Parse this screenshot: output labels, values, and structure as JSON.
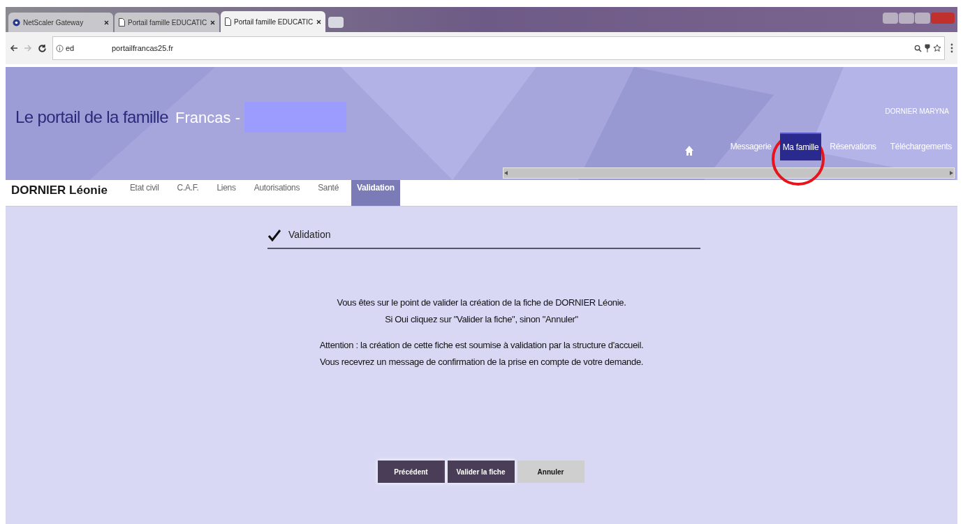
{
  "browser": {
    "tabs": [
      {
        "title": "NetScaler Gateway",
        "selected": false,
        "kind": "gateway"
      },
      {
        "title": "Portail famille EDUCATIC",
        "selected": false,
        "kind": "page"
      },
      {
        "title": "Portail famille EDUCATIC",
        "selected": true,
        "kind": "page"
      }
    ],
    "address": {
      "security_label": "ed",
      "url": "portailfrancas25.fr"
    }
  },
  "header": {
    "title": "Le portail de la famille",
    "subtitle": "Francas -",
    "user": "DORNIER MARYNA",
    "nav": [
      {
        "label": "Messagerie",
        "selected": false
      },
      {
        "label": "Ma famille",
        "selected": true
      },
      {
        "label": "Réservations",
        "selected": false
      },
      {
        "label": "Téléchargements",
        "selected": false
      }
    ]
  },
  "person": {
    "name": "DORNIER Léonie",
    "tabs": [
      {
        "label": "Etat civil",
        "selected": false
      },
      {
        "label": "C.A.F.",
        "selected": false
      },
      {
        "label": "Liens",
        "selected": false
      },
      {
        "label": "Autorisations",
        "selected": false
      },
      {
        "label": "Santé",
        "selected": false
      },
      {
        "label": "Validation",
        "selected": true
      }
    ]
  },
  "section": {
    "title": "Validation",
    "paragraphs": [
      [
        "Vous êtes sur le point de valider la création de la fiche de DORNIER Léonie.",
        "Si Oui cliquez sur \"Valider la fiche\", sinon \"Annuler\""
      ],
      [
        "Attention : la création de cette fiche est soumise à validation par la structure d'accueil.",
        "Vous recevrez un message de confirmation de la prise en compte de votre demande."
      ]
    ],
    "buttons": [
      {
        "label": "Précédent",
        "kind": "primary"
      },
      {
        "label": "Valider la fiche",
        "kind": "primary"
      },
      {
        "label": "Annuler",
        "kind": "secondary"
      }
    ]
  }
}
